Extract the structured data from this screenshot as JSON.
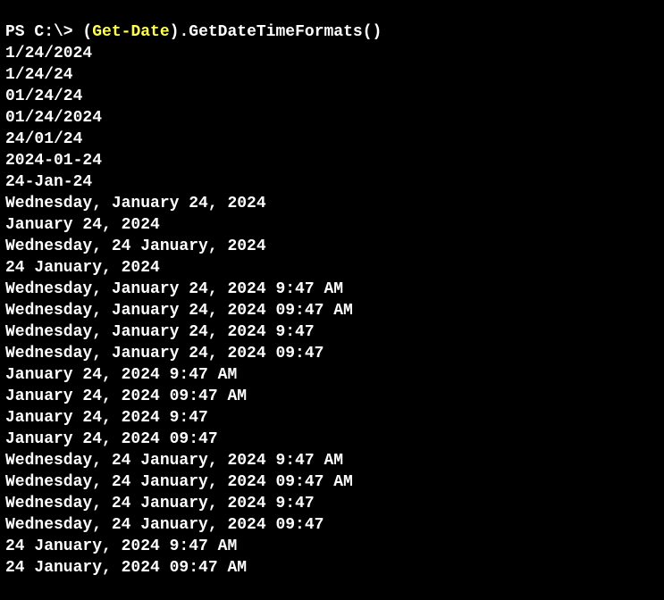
{
  "prompt": {
    "prefix": "PS C:\\> ",
    "open_paren": "(",
    "cmdlet": "Get-Date",
    "close_paren": ")",
    "method": ".GetDateTimeFormats()"
  },
  "output": [
    "1/24/2024",
    "1/24/24",
    "01/24/24",
    "01/24/2024",
    "24/01/24",
    "2024-01-24",
    "24-Jan-24",
    "Wednesday, January 24, 2024",
    "January 24, 2024",
    "Wednesday, 24 January, 2024",
    "24 January, 2024",
    "Wednesday, January 24, 2024 9:47 AM",
    "Wednesday, January 24, 2024 09:47 AM",
    "Wednesday, January 24, 2024 9:47",
    "Wednesday, January 24, 2024 09:47",
    "January 24, 2024 9:47 AM",
    "January 24, 2024 09:47 AM",
    "January 24, 2024 9:47",
    "January 24, 2024 09:47",
    "Wednesday, 24 January, 2024 9:47 AM",
    "Wednesday, 24 January, 2024 09:47 AM",
    "Wednesday, 24 January, 2024 9:47",
    "Wednesday, 24 January, 2024 09:47",
    "24 January, 2024 9:47 AM",
    "24 January, 2024 09:47 AM"
  ]
}
